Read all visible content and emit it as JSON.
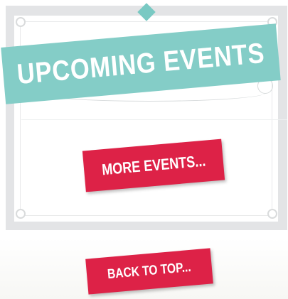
{
  "events_panel": {
    "title": "UPCOMING EVENTS",
    "more_events_label": "MORE EVENTS..."
  },
  "footer": {
    "back_to_top_label": "BACK TO TOP..."
  },
  "colors": {
    "banner": "#84cdc7",
    "button": "#dd2247",
    "frame": "#e3e4e6"
  }
}
